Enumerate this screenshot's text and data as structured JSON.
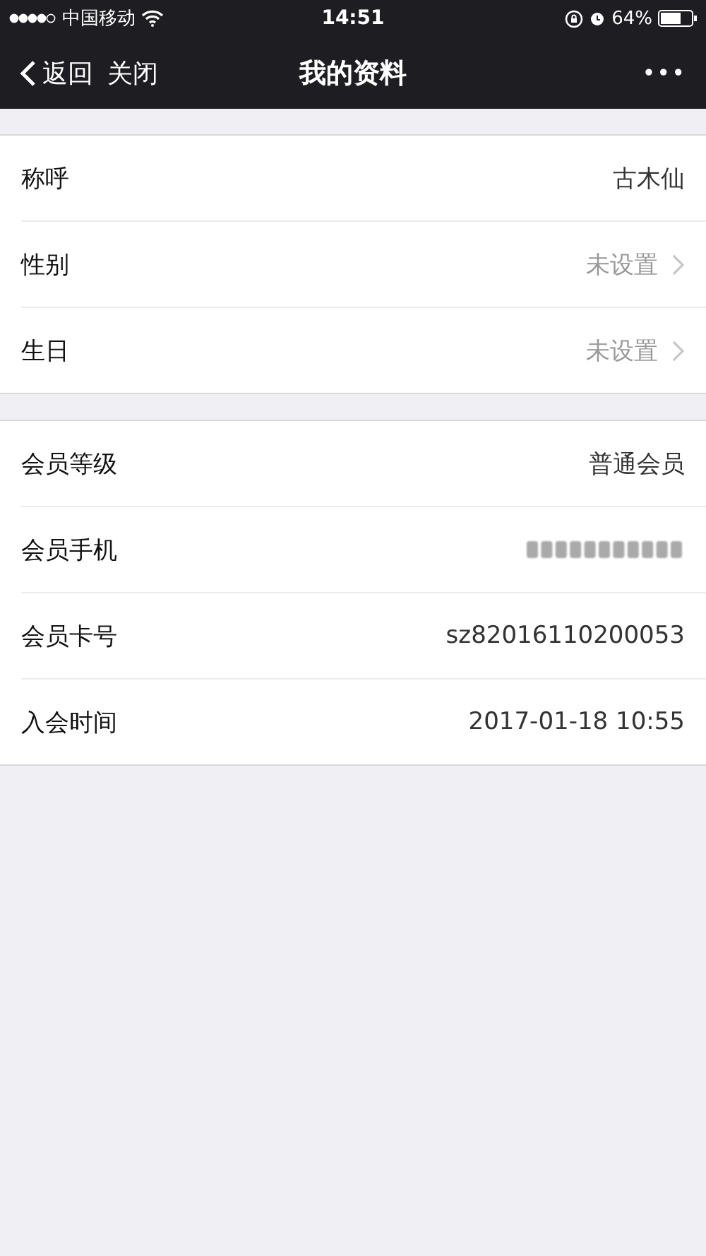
{
  "status_bar": {
    "carrier": "中国移动",
    "time": "14:51",
    "battery": "64%"
  },
  "nav_bar": {
    "back": "返回",
    "close": "关闭",
    "title": "我的资料",
    "more": "•••"
  },
  "sections": [
    {
      "rows": [
        {
          "label": "称呼",
          "value": "古木仙",
          "chevron": false,
          "muted": false,
          "blurred": false
        },
        {
          "label": "性别",
          "value": "未设置",
          "chevron": true,
          "muted": true,
          "blurred": false
        },
        {
          "label": "生日",
          "value": "未设置",
          "chevron": true,
          "muted": true,
          "blurred": false
        }
      ]
    },
    {
      "rows": [
        {
          "label": "会员等级",
          "value": "普通会员",
          "chevron": false,
          "muted": false,
          "blurred": false
        },
        {
          "label": "会员手机",
          "chevron": false,
          "muted": false,
          "blurred": true
        },
        {
          "label": "会员卡号",
          "value": "sz82016110200053",
          "chevron": false,
          "muted": false,
          "blurred": false
        },
        {
          "label": "入会时间",
          "value": "2017-01-18 10:55",
          "chevron": false,
          "muted": false,
          "blurred": false
        }
      ]
    }
  ]
}
